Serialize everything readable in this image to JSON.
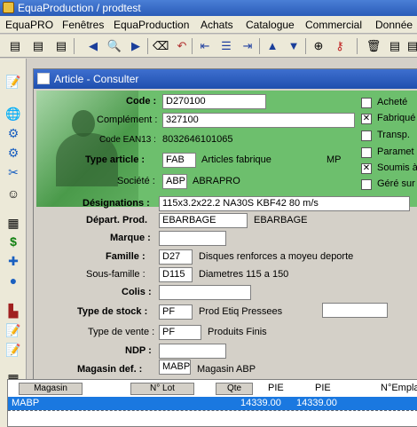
{
  "app": {
    "title": "EquaProduction /  prodtest"
  },
  "menu": [
    "EquaPRO",
    "Fenêtres",
    "EquaProduction",
    "Achats",
    "Catalogue",
    "Commercial",
    "Donnée"
  ],
  "window": {
    "title": "Article - Consulter"
  },
  "header": {
    "code": {
      "label": "Code :",
      "value": "D270100"
    },
    "complement": {
      "label": "Complément :",
      "value": "327100"
    },
    "ean": {
      "label": "Code EAN13 :",
      "value": "8032646101065"
    },
    "type_article": {
      "label": "Type article :",
      "code": "FAB",
      "desc": "Articles fabrique",
      "mp": "MP"
    },
    "societe": {
      "label": "Société :",
      "code": "ABP",
      "desc": "ABRAPRO"
    }
  },
  "checkboxes": [
    {
      "label": "Acheté",
      "checked": false
    },
    {
      "label": "Fabriqué",
      "checked": true
    },
    {
      "label": "Transp.",
      "checked": false
    },
    {
      "label": "Paramet",
      "checked": false
    },
    {
      "label": "Soumis à",
      "checked": true
    },
    {
      "label": "Géré sur",
      "checked": false
    }
  ],
  "form": {
    "designations": {
      "label": "Désignations :",
      "value": "115x3.2x22.2 NA30S KBF42 80 m/s"
    },
    "depart": {
      "label": "Départ. Prod.",
      "code": "EBARBAGE",
      "desc": "EBARBAGE"
    },
    "marque": {
      "label": "Marque :",
      "value": ""
    },
    "famille": {
      "label": "Famille :",
      "code": "D27",
      "desc": "Disques renforces a moyeu deporte"
    },
    "sous_famille": {
      "label": "Sous-famille :",
      "code": "D115",
      "desc": "Diametres 115 a 150"
    },
    "colis": {
      "label": "Colis :",
      "value": ""
    },
    "type_stock": {
      "label": "Type de stock :",
      "code": "PF",
      "desc": "Prod Etiq Pressees"
    },
    "type_vente": {
      "label": "Type de vente :",
      "code": "PF",
      "desc": "Produits Finis"
    },
    "ndp": {
      "label": "NDP :",
      "value": ""
    },
    "magasin": {
      "label": "Magasin  def. :",
      "code": "MABP",
      "desc": "Magasin ABP"
    }
  },
  "grid": {
    "buttons": [
      "Magasin",
      "N° Lot",
      "Qte"
    ],
    "columns": [
      "PIE",
      "PIE",
      "N°Empla"
    ],
    "rows": [
      {
        "magasin": "MABP",
        "qte": "14339.00",
        "pie": "14339.00"
      }
    ]
  },
  "colors": {
    "form_bg": "#6dbf6d",
    "title_bar": "#2a5cb8",
    "selected_row": "#1a78e0"
  }
}
